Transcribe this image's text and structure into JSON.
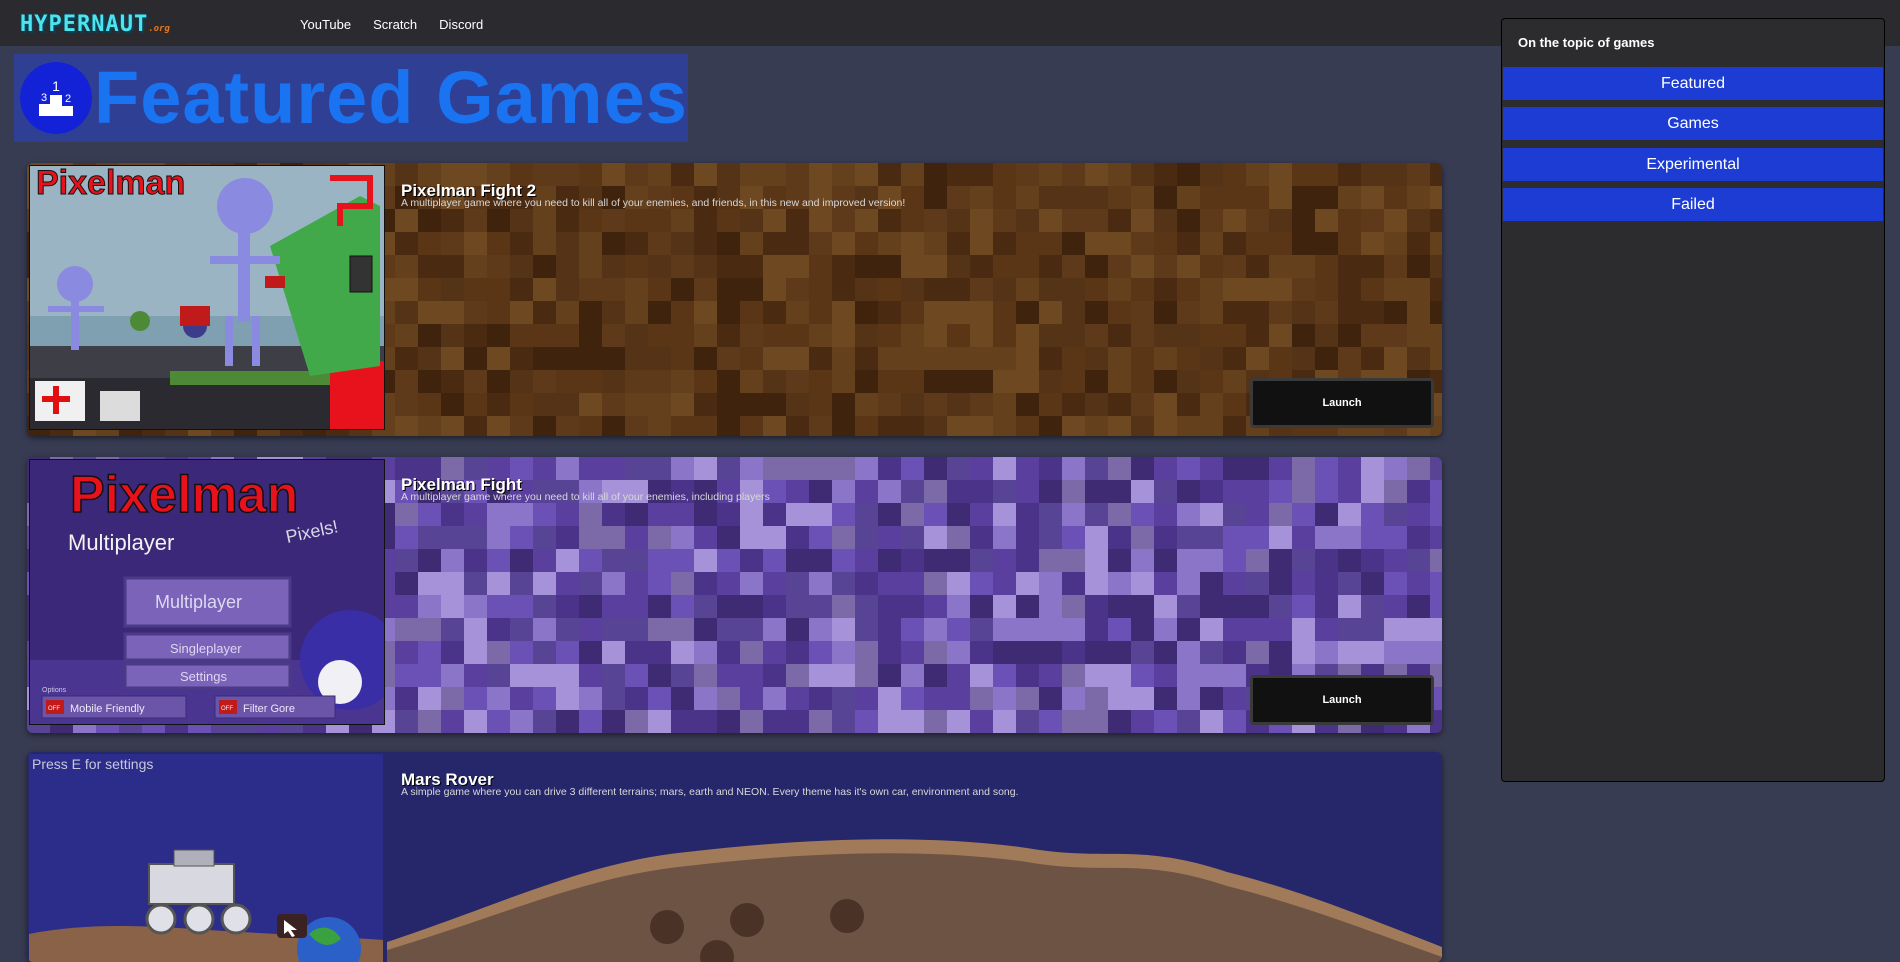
{
  "nav": {
    "logo": "HYPERNAUT",
    "logo_suffix": ".org",
    "links": [
      "YouTube",
      "Scratch",
      "Discord"
    ]
  },
  "header": {
    "title": "Featured Games",
    "badge_digits": [
      "1",
      "2",
      "3"
    ]
  },
  "sidebar": {
    "title": "On the topic of games",
    "items": [
      "Featured",
      "Games",
      "Experimental",
      "Failed"
    ]
  },
  "games": [
    {
      "title": "Pixelman Fight 2",
      "description": "A multiplayer game where you need to kill all of your enemies, and friends, in this new and improved version!",
      "launch_label": "Launch",
      "thumbnail_text": "Pixelman",
      "theme_color": "#5a3516"
    },
    {
      "title": "Pixelman Fight",
      "description": "A multiplayer game where you need to kill all of your enemies, including players",
      "launch_label": "Launch",
      "thumbnail_text": {
        "title": "Pixelman",
        "subtitle": "Multiplayer",
        "pixels": "Pixels!",
        "menu": [
          "Multiplayer",
          "Singleplayer",
          "Settings"
        ],
        "options_label": "Options",
        "mobile": "Mobile Friendly",
        "filter": "Filter Gore",
        "off": "OFF"
      },
      "theme_color": "#5a3f9e"
    },
    {
      "title": "Mars Rover",
      "description": "A simple game where you can drive 3 different terrains; mars, earth and NEON. Every theme has it's own car, environment and song.",
      "thumbnail_text": "Press E for settings",
      "theme_color": "#26266a"
    }
  ]
}
